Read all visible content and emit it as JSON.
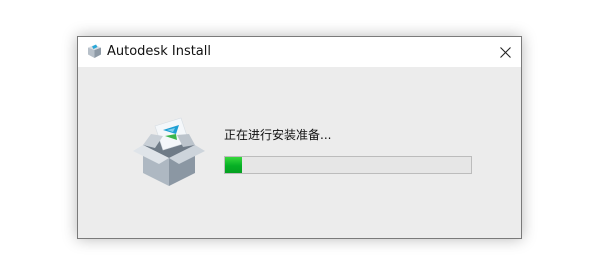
{
  "window": {
    "title": "Autodesk Install",
    "title_icon": "autodesk-package-icon",
    "close_icon": "close-icon"
  },
  "main": {
    "icon": "autodesk-box-icon",
    "status_text": "正在进行安装准备...",
    "progress_fraction": 0.07,
    "progress_color": "#06b025"
  }
}
